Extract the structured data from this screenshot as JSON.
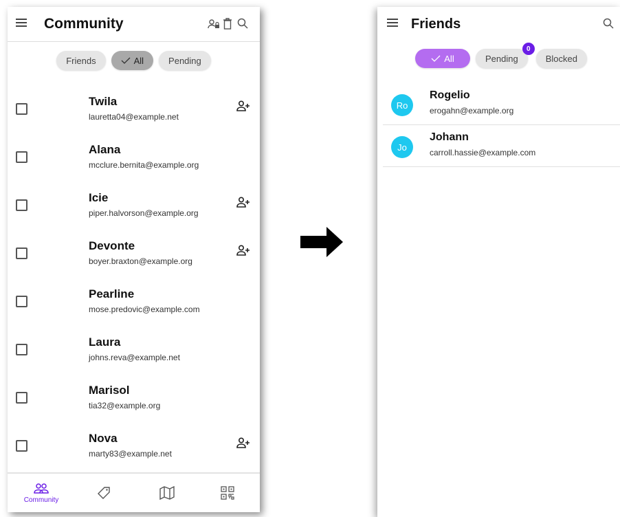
{
  "community": {
    "title": "Community",
    "chips": [
      {
        "label": "Friends",
        "selected": false
      },
      {
        "label": "All",
        "selected": true
      },
      {
        "label": "Pending",
        "selected": false
      }
    ],
    "users": [
      {
        "name": "Twila",
        "email": "lauretta04@example.net",
        "add": true
      },
      {
        "name": "Alana",
        "email": "mcclure.bernita@example.org",
        "add": false
      },
      {
        "name": "Icie",
        "email": "piper.halvorson@example.org",
        "add": true
      },
      {
        "name": "Devonte",
        "email": "boyer.braxton@example.org",
        "add": true
      },
      {
        "name": "Pearline",
        "email": "mose.predovic@example.com",
        "add": false
      },
      {
        "name": "Laura",
        "email": "johns.reva@example.net",
        "add": false
      },
      {
        "name": "Marisol",
        "email": "tia32@example.org",
        "add": false
      },
      {
        "name": "Nova",
        "email": "marty83@example.net",
        "add": true
      }
    ],
    "nav": {
      "community_label": "Community"
    }
  },
  "friends": {
    "title": "Friends",
    "chips": {
      "all": "All",
      "pending": "Pending",
      "pending_count": "0",
      "blocked": "Blocked"
    },
    "list": [
      {
        "initials": "Ro",
        "name": "Rogelio",
        "email": "erogahn@example.org"
      },
      {
        "initials": "Jo",
        "name": "Johann",
        "email": "carroll.hassie@example.com"
      }
    ]
  },
  "colors": {
    "accent": "#6a1de6",
    "chip_selected_purple": "#b46cf0",
    "avatar": "#1ec8ef"
  }
}
